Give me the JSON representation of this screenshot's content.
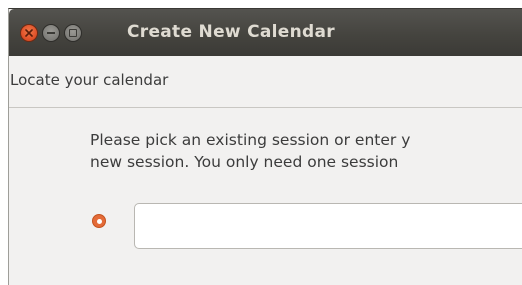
{
  "window": {
    "title": "Create New Calendar"
  },
  "section": {
    "title": "Locate your calendar"
  },
  "description": {
    "line1": "Please pick an existing session or enter y",
    "line2": "new session. You only need one session "
  },
  "session": {
    "option_selected": true,
    "input_value": "",
    "input_placeholder": ""
  },
  "colors": {
    "titlebar": "#3c3b37",
    "close_button": "#e0522a",
    "accent_radio": "#e46b38",
    "window_bg": "#f2f1f0"
  },
  "icons": {
    "close": "close-icon",
    "minimize": "minimize-icon",
    "maximize": "maximize-icon"
  }
}
